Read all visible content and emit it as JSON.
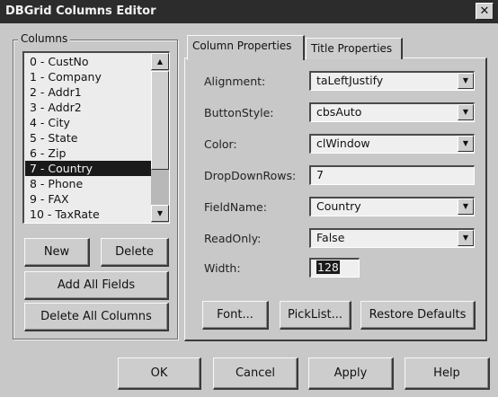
{
  "window": {
    "title": "DBGrid Columns Editor",
    "close_glyph": "✕"
  },
  "columns_group": {
    "label": "Columns",
    "items": [
      {
        "label": "0 - CustNo"
      },
      {
        "label": "1 - Company"
      },
      {
        "label": "2 - Addr1"
      },
      {
        "label": "3 - Addr2"
      },
      {
        "label": "4 - City"
      },
      {
        "label": "5 - State"
      },
      {
        "label": "6 - Zip"
      },
      {
        "label": "7 - Country"
      },
      {
        "label": "8 - Phone"
      },
      {
        "label": "9 - FAX"
      },
      {
        "label": "10 - TaxRate"
      }
    ],
    "selected_label": "7 - Country",
    "scroll_up_glyph": "▲",
    "scroll_down_glyph": "▼",
    "new_label": "New",
    "delete_label": "Delete",
    "add_all_label": "Add All Fields",
    "delete_all_label": "Delete All Columns"
  },
  "tabs": [
    {
      "label": "Column Properties",
      "active": true
    },
    {
      "label": "Title Properties",
      "active": false
    }
  ],
  "properties": {
    "alignment": {
      "label": "Alignment:",
      "value": "taLeftJustify"
    },
    "button_style": {
      "label": "ButtonStyle:",
      "value": "cbsAuto"
    },
    "color": {
      "label": "Color:",
      "value": "clWindow"
    },
    "drop_down_rows": {
      "label": "DropDownRows:",
      "value": "7"
    },
    "field_name": {
      "label": "FieldName:",
      "value": "Country"
    },
    "read_only": {
      "label": "ReadOnly:",
      "value": "False"
    },
    "width": {
      "label": "Width:",
      "value": "128"
    },
    "combo_glyph": "▼"
  },
  "panel_buttons": {
    "font_label": "Font...",
    "picklist_label": "PickList...",
    "restore_label": "Restore Defaults"
  },
  "dialog_buttons": {
    "ok_label": "OK",
    "cancel_label": "Cancel",
    "apply_label": "Apply",
    "help_label": "Help"
  }
}
